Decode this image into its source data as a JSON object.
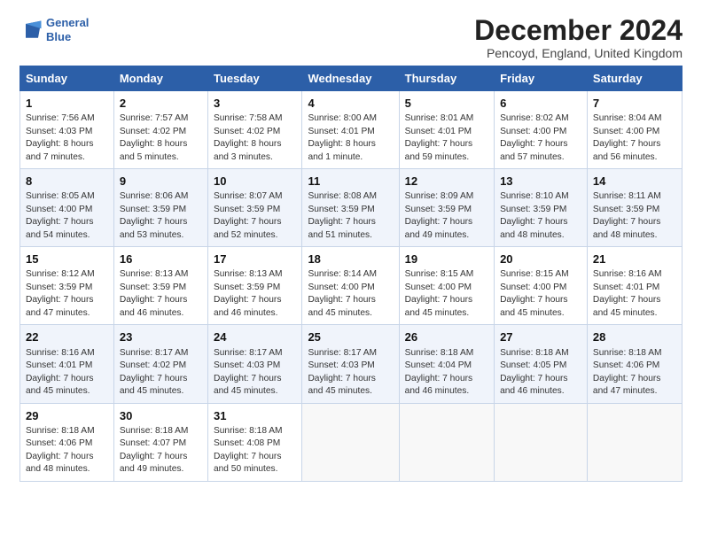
{
  "logo": {
    "line1": "General",
    "line2": "Blue"
  },
  "title": "December 2024",
  "subtitle": "Pencoyd, England, United Kingdom",
  "days_of_week": [
    "Sunday",
    "Monday",
    "Tuesday",
    "Wednesday",
    "Thursday",
    "Friday",
    "Saturday"
  ],
  "weeks": [
    [
      {
        "day": "1",
        "info": "Sunrise: 7:56 AM\nSunset: 4:03 PM\nDaylight: 8 hours\nand 7 minutes."
      },
      {
        "day": "2",
        "info": "Sunrise: 7:57 AM\nSunset: 4:02 PM\nDaylight: 8 hours\nand 5 minutes."
      },
      {
        "day": "3",
        "info": "Sunrise: 7:58 AM\nSunset: 4:02 PM\nDaylight: 8 hours\nand 3 minutes."
      },
      {
        "day": "4",
        "info": "Sunrise: 8:00 AM\nSunset: 4:01 PM\nDaylight: 8 hours\nand 1 minute."
      },
      {
        "day": "5",
        "info": "Sunrise: 8:01 AM\nSunset: 4:01 PM\nDaylight: 7 hours\nand 59 minutes."
      },
      {
        "day": "6",
        "info": "Sunrise: 8:02 AM\nSunset: 4:00 PM\nDaylight: 7 hours\nand 57 minutes."
      },
      {
        "day": "7",
        "info": "Sunrise: 8:04 AM\nSunset: 4:00 PM\nDaylight: 7 hours\nand 56 minutes."
      }
    ],
    [
      {
        "day": "8",
        "info": "Sunrise: 8:05 AM\nSunset: 4:00 PM\nDaylight: 7 hours\nand 54 minutes."
      },
      {
        "day": "9",
        "info": "Sunrise: 8:06 AM\nSunset: 3:59 PM\nDaylight: 7 hours\nand 53 minutes."
      },
      {
        "day": "10",
        "info": "Sunrise: 8:07 AM\nSunset: 3:59 PM\nDaylight: 7 hours\nand 52 minutes."
      },
      {
        "day": "11",
        "info": "Sunrise: 8:08 AM\nSunset: 3:59 PM\nDaylight: 7 hours\nand 51 minutes."
      },
      {
        "day": "12",
        "info": "Sunrise: 8:09 AM\nSunset: 3:59 PM\nDaylight: 7 hours\nand 49 minutes."
      },
      {
        "day": "13",
        "info": "Sunrise: 8:10 AM\nSunset: 3:59 PM\nDaylight: 7 hours\nand 48 minutes."
      },
      {
        "day": "14",
        "info": "Sunrise: 8:11 AM\nSunset: 3:59 PM\nDaylight: 7 hours\nand 48 minutes."
      }
    ],
    [
      {
        "day": "15",
        "info": "Sunrise: 8:12 AM\nSunset: 3:59 PM\nDaylight: 7 hours\nand 47 minutes."
      },
      {
        "day": "16",
        "info": "Sunrise: 8:13 AM\nSunset: 3:59 PM\nDaylight: 7 hours\nand 46 minutes."
      },
      {
        "day": "17",
        "info": "Sunrise: 8:13 AM\nSunset: 3:59 PM\nDaylight: 7 hours\nand 46 minutes."
      },
      {
        "day": "18",
        "info": "Sunrise: 8:14 AM\nSunset: 4:00 PM\nDaylight: 7 hours\nand 45 minutes."
      },
      {
        "day": "19",
        "info": "Sunrise: 8:15 AM\nSunset: 4:00 PM\nDaylight: 7 hours\nand 45 minutes."
      },
      {
        "day": "20",
        "info": "Sunrise: 8:15 AM\nSunset: 4:00 PM\nDaylight: 7 hours\nand 45 minutes."
      },
      {
        "day": "21",
        "info": "Sunrise: 8:16 AM\nSunset: 4:01 PM\nDaylight: 7 hours\nand 45 minutes."
      }
    ],
    [
      {
        "day": "22",
        "info": "Sunrise: 8:16 AM\nSunset: 4:01 PM\nDaylight: 7 hours\nand 45 minutes."
      },
      {
        "day": "23",
        "info": "Sunrise: 8:17 AM\nSunset: 4:02 PM\nDaylight: 7 hours\nand 45 minutes."
      },
      {
        "day": "24",
        "info": "Sunrise: 8:17 AM\nSunset: 4:03 PM\nDaylight: 7 hours\nand 45 minutes."
      },
      {
        "day": "25",
        "info": "Sunrise: 8:17 AM\nSunset: 4:03 PM\nDaylight: 7 hours\nand 45 minutes."
      },
      {
        "day": "26",
        "info": "Sunrise: 8:18 AM\nSunset: 4:04 PM\nDaylight: 7 hours\nand 46 minutes."
      },
      {
        "day": "27",
        "info": "Sunrise: 8:18 AM\nSunset: 4:05 PM\nDaylight: 7 hours\nand 46 minutes."
      },
      {
        "day": "28",
        "info": "Sunrise: 8:18 AM\nSunset: 4:06 PM\nDaylight: 7 hours\nand 47 minutes."
      }
    ],
    [
      {
        "day": "29",
        "info": "Sunrise: 8:18 AM\nSunset: 4:06 PM\nDaylight: 7 hours\nand 48 minutes."
      },
      {
        "day": "30",
        "info": "Sunrise: 8:18 AM\nSunset: 4:07 PM\nDaylight: 7 hours\nand 49 minutes."
      },
      {
        "day": "31",
        "info": "Sunrise: 8:18 AM\nSunset: 4:08 PM\nDaylight: 7 hours\nand 50 minutes."
      },
      {
        "day": "",
        "info": ""
      },
      {
        "day": "",
        "info": ""
      },
      {
        "day": "",
        "info": ""
      },
      {
        "day": "",
        "info": ""
      }
    ]
  ]
}
